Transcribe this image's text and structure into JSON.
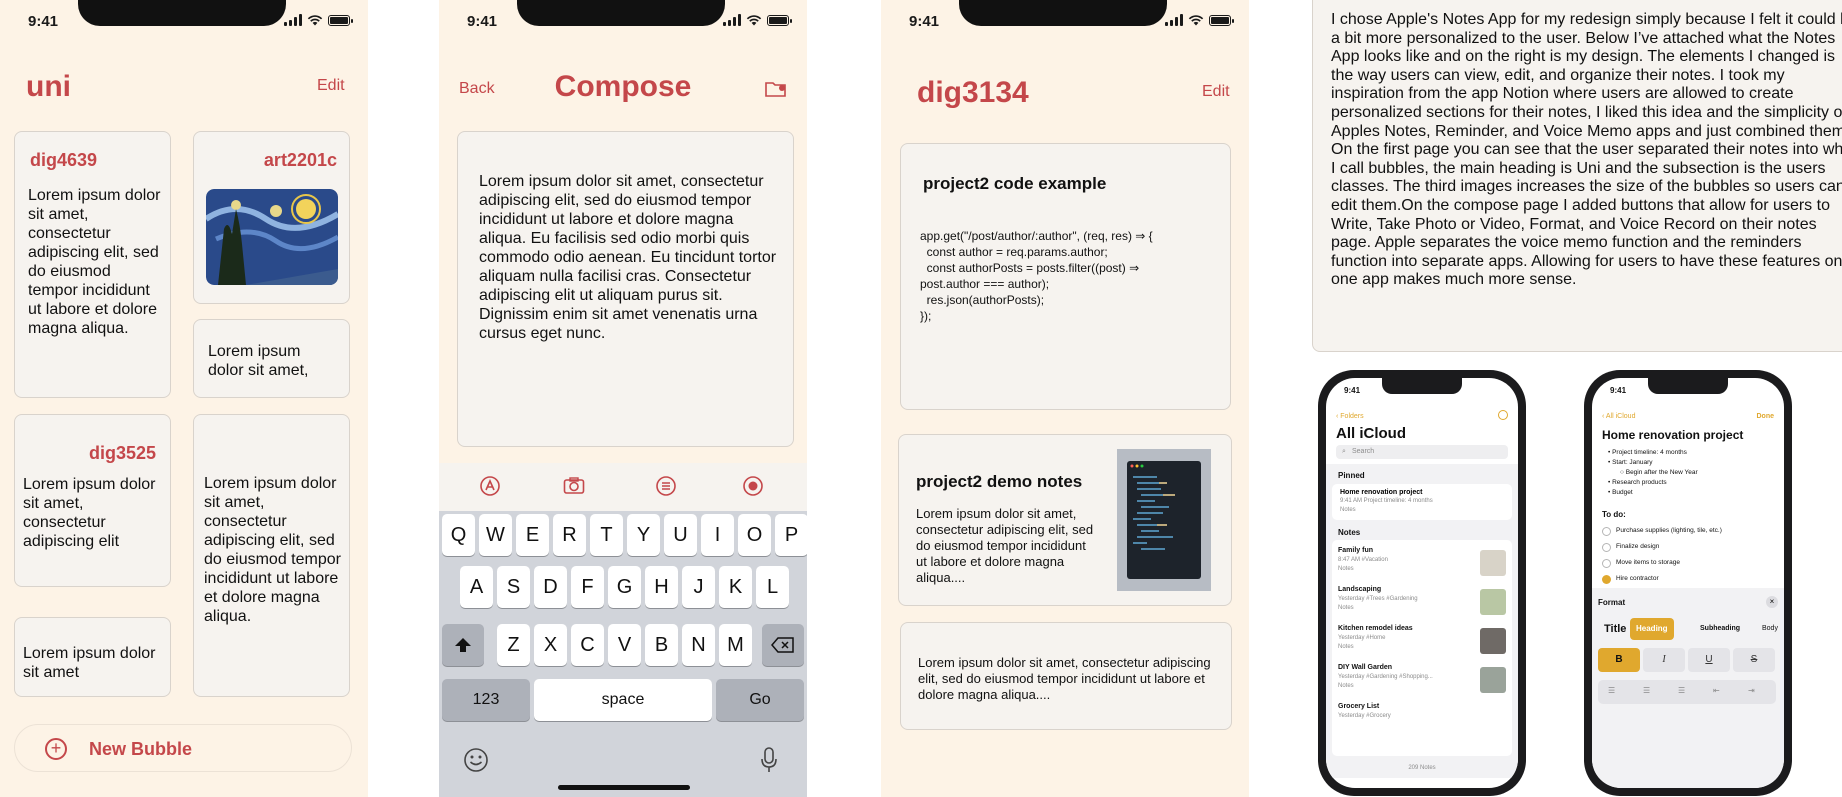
{
  "status": {
    "time": "9:41"
  },
  "screen1": {
    "title": "uni",
    "edit": "Edit",
    "bubbles": [
      {
        "title": "dig4639",
        "text": "Lorem ipsum dolor sit amet, consectetur adipiscing elit, sed do eiusmod tempor incididunt ut labore et dolore magna aliqua."
      },
      {
        "title": "art2201c"
      },
      {
        "text": "Lorem ipsum dolor sit amet,"
      },
      {
        "title": "dig3525",
        "text": "Lorem ipsum dolor sit amet, consectetur adipiscing elit"
      },
      {
        "text": "Lorem ipsum dolor sit amet, consectetur adipiscing elit, sed do eiusmod tempor incididunt ut labore et dolore magna aliqua."
      },
      {
        "text": "Lorem ipsum dolor sit amet"
      }
    ],
    "new_bubble": "New Bubble",
    "new_bubble_icon": "+"
  },
  "screen2": {
    "back": "Back",
    "title": "Compose",
    "body": "Lorem ipsum dolor sit amet, consectetur adipiscing elit, sed do eiusmod tempor incididunt ut labore et dolore magna aliqua. Eu facilisis sed odio morbi quis commodo odio aenean. Eu tincidunt tortor aliquam nulla facilisi cras. Consectetur adipiscing elit ut aliquam purus sit. Dignissim enim sit amet venenatis urna cursus eget nunc.",
    "toolbar_icons": [
      "write-icon",
      "camera-icon",
      "format-icon",
      "record-icon"
    ],
    "keyboard": {
      "row1": [
        "Q",
        "W",
        "E",
        "R",
        "T",
        "Y",
        "U",
        "I",
        "O",
        "P"
      ],
      "row2": [
        "A",
        "S",
        "D",
        "F",
        "G",
        "H",
        "J",
        "K",
        "L"
      ],
      "row3": [
        "Z",
        "X",
        "C",
        "V",
        "B",
        "N",
        "M"
      ],
      "numbers": "123",
      "space": "space",
      "go": "Go"
    }
  },
  "screen3": {
    "title": "dig3134",
    "edit": "Edit",
    "note1_title": "project2 code example",
    "note1_code": "app.get(\"/post/author/:author\", (req, res) ⇒ {\n  const author = req.params.author;\n  const authorPosts = posts.filter((post) ⇒\npost.author === author);\n  res.json(authorPosts);\n});",
    "note2_title": "project2 demo notes",
    "note2_text": "Lorem ipsum dolor sit amet, consectetur adipiscing elit, sed do eiusmod tempor incididunt ut labore et dolore magna aliqua....",
    "note3_text": "Lorem ipsum dolor sit amet, consectetur adipiscing elit, sed do eiusmod tempor incididunt ut labore et dolore magna aliqua...."
  },
  "description": "I chose Apple's Notes App for my redesign simply because I felt it could be a bit more personalized to the user. Below I’ve attached what the Notes App looks like and on the right is my design. The elements I changed is the way users can view, edit, and organize their notes. I took my inspiration from the app Notion where users are allowed to create personalized sections for their notes, I liked this idea and the simplicity of Apples Notes, Reminder, and Voice Memo apps and just combined them. On the first page you can see that the user separated their notes into what I call bubbles, the main heading is Uni and the subsection is the users classes. The third images increases the size of the bubbles so users can edit them.On the compose page I added buttons that allow for users to Write, Take Photo or Video, Format, and Voice Record on their notes page. Apple separates the voice memo function and the reminders function into separate apps. Allowing for users to have these features on one app makes much more sense.",
  "phoneA": {
    "time": "9:41",
    "back": "Folders",
    "title": "All iCloud",
    "search": "Search",
    "pinned": "Pinned",
    "pinned_note": {
      "title": "Home renovation project",
      "meta": "9:41 AM  Project timeline: 4 months",
      "folder": "Notes"
    },
    "notes_header": "Notes",
    "notes": [
      {
        "title": "Family fun",
        "meta": "8:47 AM  #Vacation",
        "folder": "Notes"
      },
      {
        "title": "Landscaping",
        "meta": "Yesterday  #Trees #Gardening",
        "folder": "Notes"
      },
      {
        "title": "Kitchen remodel ideas",
        "meta": "Yesterday  #Home",
        "folder": "Notes"
      },
      {
        "title": "DIY Wall Garden",
        "meta": "Yesterday  #Gardening #Shopping...",
        "folder": "Notes"
      },
      {
        "title": "Grocery List",
        "meta": "Yesterday  #Grocery",
        "folder": ""
      }
    ],
    "count": "209 Notes"
  },
  "phoneB": {
    "time": "9:41",
    "back": "All iCloud",
    "done": "Done",
    "title": "Home renovation project",
    "bullets": [
      "Project timeline: 4 months",
      "Start: January",
      "Begin after the New Year",
      "Research products",
      "Budget"
    ],
    "todo": "To do:",
    "tasks": [
      "Purchase supplies (lighting, tile, etc.)",
      "Finalize design",
      "Move items to storage",
      "Hire contractor"
    ],
    "format": "Format",
    "styles": [
      "Title",
      "Heading",
      "Subheading",
      "Body"
    ],
    "marks": [
      "B",
      "I",
      "U",
      "S"
    ]
  },
  "colors": {
    "accent": "#c4474a",
    "bg": "#fdf3e6",
    "card": "#f6f3ef",
    "ios_gold": "#e0a82e"
  }
}
